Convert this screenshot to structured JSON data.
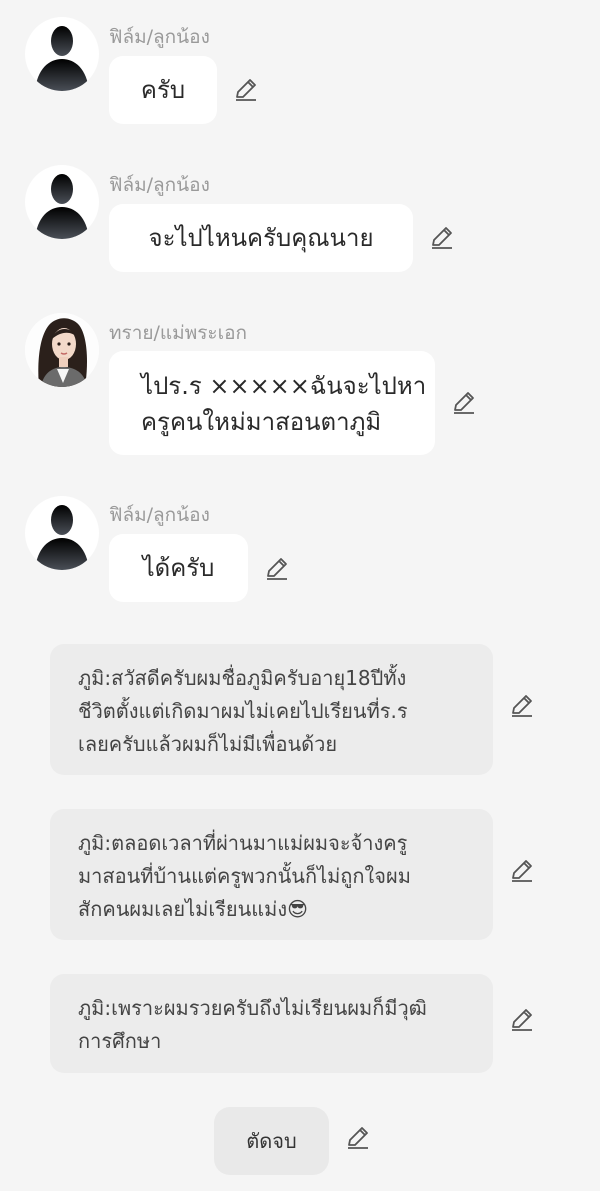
{
  "messages": [
    {
      "sender": "ฟิล์ม/ลูกน้อง",
      "text": "ครับ",
      "avatar": "silhouette-avatar"
    },
    {
      "sender": "ฟิล์ม/ลูกน้อง",
      "text": "จะไปไหนครับคุณนาย",
      "avatar": "silhouette-avatar"
    },
    {
      "sender": "ทราย/แม่พระเอก",
      "lines": [
        "ไปร.ร ×××××ฉันจะไปหา",
        "ครูคนใหม่มาสอนตาภูมิ"
      ],
      "avatar": "woman-portrait-avatar"
    },
    {
      "sender": "ฟิล์ม/ลูกน้อง",
      "text": "ได้ครับ",
      "avatar": "silhouette-avatar"
    }
  ],
  "narration": [
    {
      "lines": [
        "ภูมิ:สวัสดีครับผมชื่อภูมิครับอายุ18ปีทั้ง",
        "ชีวิตตั้งแต่เกิดมาผมไม่เคยไปเรียนที่ร.ร",
        "เลยครับแล้วผมก็ไม่มีเพื่อนด้วย"
      ]
    },
    {
      "lines": [
        "ภูมิ:ตลอดเวลาที่ผ่านมาแม่ผมจะจ้างครู",
        "มาสอนที่บ้านแต่ครูพวกนั้นก็ไม่ถูกใจผม",
        "สักคนผมเลยไม่เรียนแม่ง😎"
      ]
    },
    {
      "lines": [
        "ภูมิ:เพราะผมรวยครับถึงไม่เรียนผมก็มีวุฒิ",
        "การศึกษา"
      ]
    }
  ],
  "end_button": {
    "label": "ตัดจบ"
  },
  "colors": {
    "background": "#f5f5f5",
    "bubble": "#ffffff",
    "narration_bubble": "#ececec",
    "sender_text": "#9a9a9a",
    "icon": "#555555"
  },
  "icons": {
    "edit": "pencil-icon"
  }
}
